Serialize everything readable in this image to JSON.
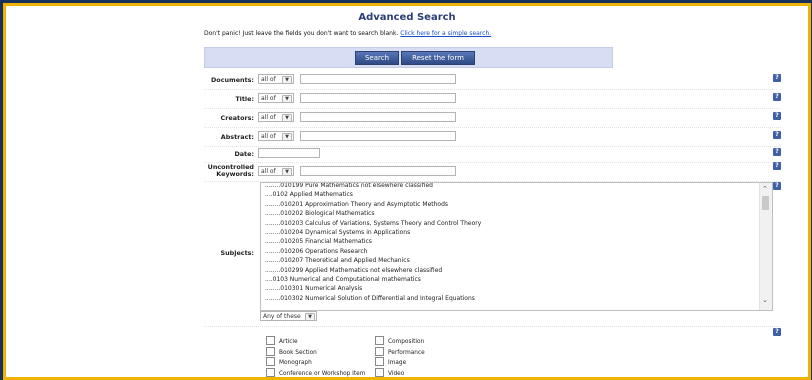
{
  "form": {
    "title": "Advanced Search",
    "intro_text": "Don't panic! Just leave the fields you don't want to search blank.",
    "intro_link": "Click here for a simple search.",
    "search_button": "Search",
    "reset_button": "Reset the form"
  },
  "fields": {
    "documents": {
      "label": "Documents:",
      "match": "all of",
      "value": ""
    },
    "title": {
      "label": "Title:",
      "match": "all of",
      "value": ""
    },
    "creators": {
      "label": "Creators:",
      "match": "all of",
      "value": ""
    },
    "abstract": {
      "label": "Abstract:",
      "match": "all of",
      "value": ""
    },
    "date": {
      "label": "Date:",
      "value": ""
    },
    "keywords": {
      "label": "Uncontrolled Keywords:",
      "match": "all of",
      "value": ""
    }
  },
  "subjects": {
    "label": "Subjects:",
    "items": [
      "........010199 Pure Mathematics not elsewhere classified",
      "....0102 Applied Mathematics",
      "........010201 Approximation Theory and Asymptotic Methods",
      "........010202 Biological Mathematics",
      "........010203 Calculus of Variations, Systems Theory and Control Theory",
      "........010204 Dynamical Systems in Applications",
      "........010205 Financial Mathematics",
      "........010206 Operations Research",
      "........010207 Theoretical and Applied Mechanics",
      "........010299 Applied Mathematics not elsewhere classified",
      "....0103 Numerical and Computational mathematics",
      "........010301 Numerical Analysis",
      "........010302 Numerical Solution of Differential and Integral Equations"
    ],
    "match": "Any of these"
  },
  "item_types": {
    "left": [
      "Article",
      "Book Section",
      "Monograph",
      "Conference or Workshop Item"
    ],
    "right": [
      "Composition",
      "Performance",
      "Image",
      "Video"
    ]
  },
  "icons": {
    "help": "help-icon",
    "scroll_up": "chevron-up-icon",
    "scroll_down": "chevron-down-icon"
  },
  "colors": {
    "accent": "#3f5fa7",
    "border": "#f0b400",
    "button_bar": "#d7ddf3",
    "outer": "#17325a"
  }
}
